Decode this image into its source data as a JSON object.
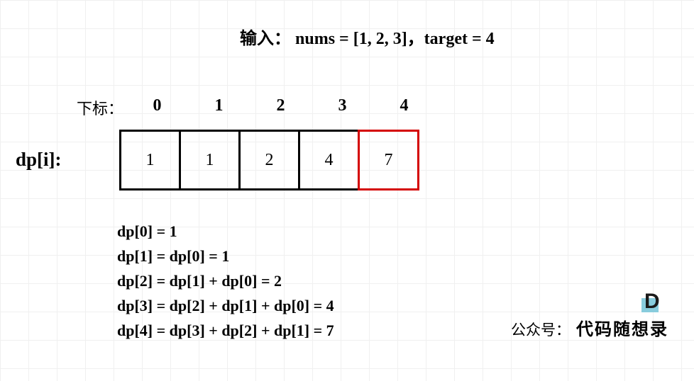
{
  "title": {
    "input_label": "输入：",
    "expression": "nums = [1, 2, 3]，target = 4"
  },
  "index_label": "下标：",
  "dp_label": "dp[i]:",
  "table": {
    "indices": [
      "0",
      "1",
      "2",
      "3",
      "4"
    ],
    "values": [
      "1",
      "1",
      "2",
      "4",
      "7"
    ],
    "highlight_index": 4
  },
  "equations": [
    "dp[0] = 1",
    "dp[1] = dp[0] = 1",
    "dp[2] = dp[1] + dp[0] = 2",
    "dp[3] = dp[2] + dp[1] + dp[0] = 4",
    "dp[4] = dp[3] + dp[2] + dp[1] = 7"
  ],
  "credit": {
    "label": "公众号：",
    "name": "代码随想录"
  },
  "chart_data": {
    "type": "table",
    "title": "DP array for Combination Sum IV",
    "input": {
      "nums": [
        1,
        2,
        3
      ],
      "target": 4
    },
    "columns": [
      "index",
      "dp[i]"
    ],
    "rows": [
      {
        "index": 0,
        "dp": 1
      },
      {
        "index": 1,
        "dp": 1
      },
      {
        "index": 2,
        "dp": 2
      },
      {
        "index": 3,
        "dp": 4
      },
      {
        "index": 4,
        "dp": 7
      }
    ],
    "recurrence": [
      "dp[0] = 1",
      "dp[1] = dp[0] = 1",
      "dp[2] = dp[1] + dp[0] = 2",
      "dp[3] = dp[2] + dp[1] + dp[0] = 4",
      "dp[4] = dp[3] + dp[2] + dp[1] = 7"
    ]
  }
}
